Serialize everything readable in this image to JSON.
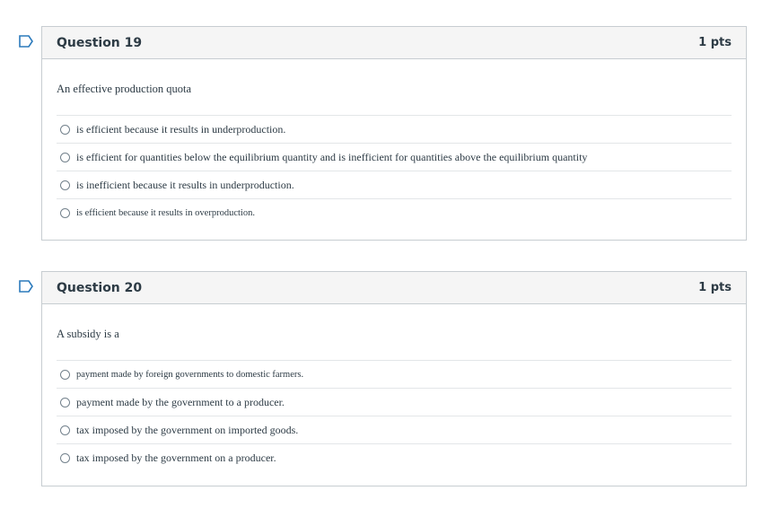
{
  "questions": [
    {
      "title": "Question 19",
      "points": "1 pts",
      "prompt": "An effective production quota",
      "answers": [
        "is efficient because it results in underproduction.",
        "is efficient for quantities below the equilibrium quantity and is inefficient for quantities above the equilibrium quantity",
        "is inefficient because it results in underproduction.",
        "is efficient because it results in overproduction."
      ]
    },
    {
      "title": "Question 20",
      "points": "1 pts",
      "prompt": "A subsidy is a",
      "answers": [
        "payment made by foreign governments to domestic farmers.",
        "payment made by the government to a producer.",
        "tax imposed by the government on imported goods.",
        "tax imposed by the government on a producer."
      ]
    }
  ],
  "colors": {
    "flag": "#2b7abc",
    "border": "#c7cdd1",
    "header_bg": "#f5f5f5",
    "text": "#2d3b45"
  },
  "icons": {
    "flag": "flag-question-icon",
    "radio": "radio-button-icon"
  }
}
